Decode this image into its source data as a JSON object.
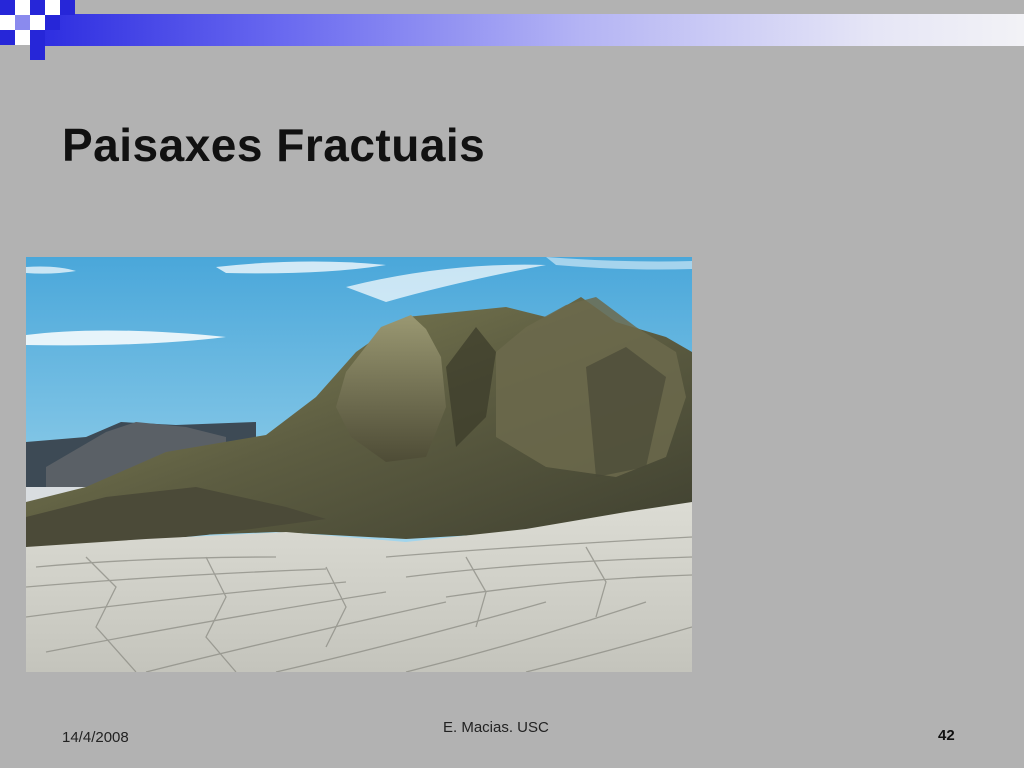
{
  "slide": {
    "title": "Paisaxes Fractuais",
    "photo": "fractal-landscape-image",
    "footer": {
      "date": "14/4/2008",
      "author": "E. Macias. USC",
      "page_number": "42"
    }
  },
  "colors": {
    "background": "#b2b2b2",
    "accent_blue": "#2d2de0",
    "title": "#111111"
  }
}
